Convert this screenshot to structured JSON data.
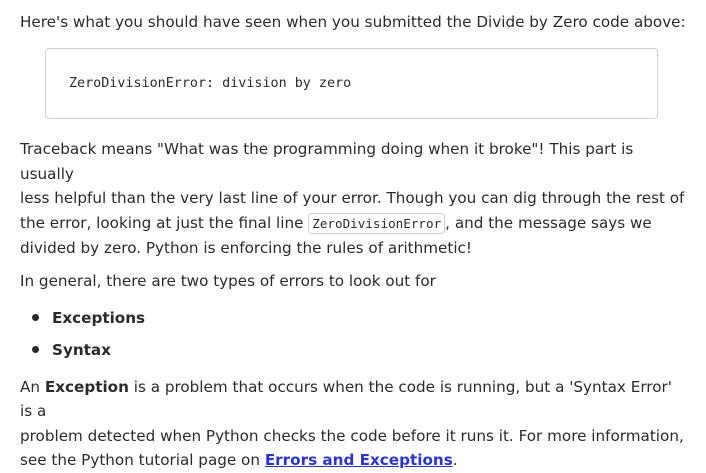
{
  "intro": "Here's what you should have seen when you submitted the Divide by Zero code above:",
  "code_block": "ZeroDivisionError: division by zero",
  "para1": {
    "line1": "Traceback means \"What was the programming doing when it broke\"! This part is usually",
    "line2": "less helpful than the very last line of your error. Though you can dig through the rest of",
    "line3_before": "the error, looking at just the final line ",
    "inline_code": "ZeroDivisionError",
    "line3_after": ", and the message says we",
    "line4": "divided by zero. Python is enforcing the rules of arithmetic!"
  },
  "para2": "In general, there are two types of errors to look out for",
  "list": [
    "Exceptions",
    "Syntax"
  ],
  "para3": {
    "prefix": "An ",
    "bold": "Exception",
    "text1": " is a problem that occurs when the code is running, but a 'Syntax Error' is a",
    "line2": "problem detected when Python checks the code before it runs it. For more information,",
    "line3": "see the Python tutorial page on ",
    "link": "Errors and Exceptions",
    "suffix": "."
  }
}
